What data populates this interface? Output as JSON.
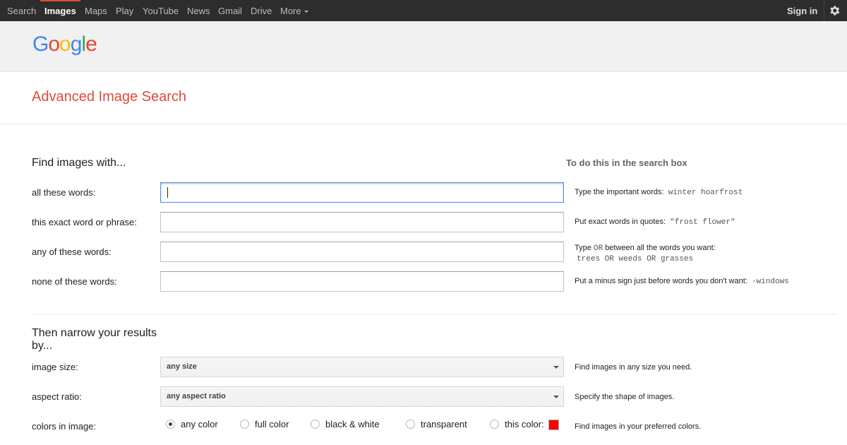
{
  "topbar": {
    "nav": [
      "Search",
      "Images",
      "Maps",
      "Play",
      "YouTube",
      "News",
      "Gmail",
      "Drive",
      "More"
    ],
    "active": "Images",
    "signin": "Sign in",
    "accent_color": "#dd4b39"
  },
  "header": {
    "logo_letters": [
      {
        "ch": "G",
        "color": "#4285f4"
      },
      {
        "ch": "o",
        "color": "#ea4335"
      },
      {
        "ch": "o",
        "color": "#fbbc05"
      },
      {
        "ch": "g",
        "color": "#4285f4"
      },
      {
        "ch": "l",
        "color": "#34a853"
      },
      {
        "ch": "e",
        "color": "#ea4335"
      }
    ]
  },
  "page": {
    "title": "Advanced Image Search",
    "find_heading": "Find images with...",
    "side_heading": "To do this in the search box",
    "narrow_heading": "Then narrow your results by..."
  },
  "fields": [
    {
      "label": "all these words:",
      "value": "",
      "hint_text": "Type the important words:",
      "hint_code": "winter hoarfrost"
    },
    {
      "label": "this exact word or phrase:",
      "value": "",
      "hint_text": "Put exact words in quotes:",
      "hint_code": "\"frost flower\""
    },
    {
      "label": "any of these words:",
      "value": "",
      "hint_text": "Type",
      "hint_code_mid": "OR",
      "hint_text2": "between all the words you want:",
      "hint_code": "trees OR weeds OR grasses"
    },
    {
      "label": "none of these words:",
      "value": "",
      "hint_text": "Put a minus sign just before words you don't want:",
      "hint_code": "-windows"
    }
  ],
  "filters": {
    "image_size": {
      "label": "image size:",
      "selected": "any size",
      "hint": "Find images in any size you need."
    },
    "aspect_ratio": {
      "label": "aspect ratio:",
      "selected": "any aspect ratio",
      "hint": "Specify the shape of images."
    },
    "colors": {
      "label": "colors in image:",
      "options": [
        "any color",
        "full color",
        "black & white",
        "transparent",
        "this color:"
      ],
      "selected": "any color",
      "swatch_color": "#ff0000",
      "hint": "Find images in your preferred colors."
    }
  },
  "icons": {
    "settings": "gear-icon",
    "more": "chevron-down-icon"
  }
}
